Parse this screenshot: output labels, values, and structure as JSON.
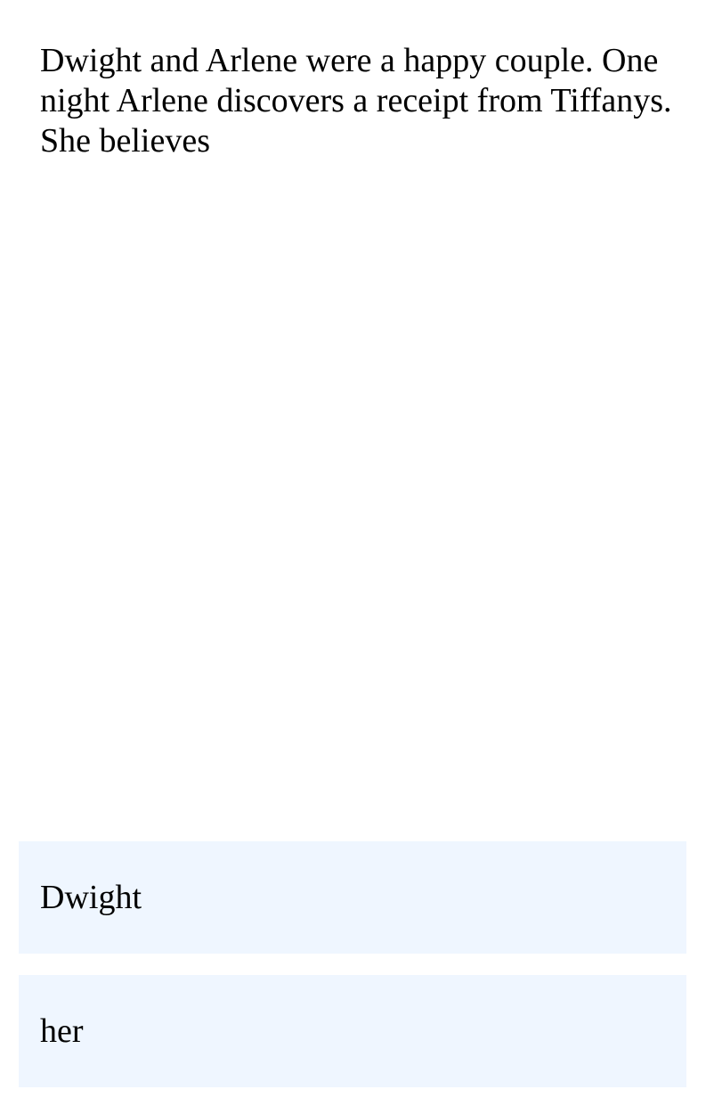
{
  "story": {
    "text": "Dwight and Arlene were a happy couple. One night Arlene discovers a receipt from Tiffanys. She believes"
  },
  "options": [
    {
      "label": "Dwight"
    },
    {
      "label": "her"
    }
  ],
  "colors": {
    "option_background": "#eff6ff",
    "text": "#000000",
    "page_background": "#ffffff"
  }
}
